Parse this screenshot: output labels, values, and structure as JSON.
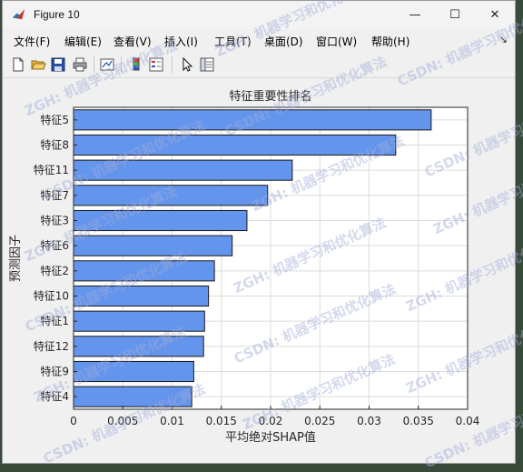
{
  "window": {
    "title": "Figure 10",
    "minimize_glyph": "—",
    "maximize_glyph": "☐",
    "close_glyph": "✕"
  },
  "menu": {
    "items": [
      "文件(F)",
      "编辑(E)",
      "查看(V)",
      "插入(I)",
      "工具(T)",
      "桌面(D)",
      "窗口(W)",
      "帮助(H)"
    ],
    "overflow_glyph": "↘"
  },
  "toolbar": {
    "icons": [
      "new-figure-icon",
      "open-file-icon",
      "save-icon",
      "print-icon",
      "link-plot-icon",
      "colorbar-icon",
      "legend-icon",
      "pointer-icon",
      "property-inspector-icon"
    ]
  },
  "watermarks": [
    "ZGH: 机器学习和优化算法",
    "CSDN: 机器学习和优化算法"
  ],
  "colors": {
    "bar_fill": "#6495ed",
    "bar_edge": "#1a1a1a",
    "axes_bg": "#ffffff",
    "grid": "#dcdcdc"
  },
  "chart_data": {
    "type": "bar",
    "orientation": "horizontal",
    "title": "特征重要性排名",
    "xlabel": "平均绝对SHAP值",
    "ylabel": "预测因子",
    "categories": [
      "特征5",
      "特征8",
      "特征11",
      "特征7",
      "特征3",
      "特征6",
      "特征2",
      "特征10",
      "特征1",
      "特征12",
      "特征9",
      "特征4"
    ],
    "values": [
      0.0363,
      0.0327,
      0.0222,
      0.0197,
      0.0176,
      0.0161,
      0.0143,
      0.0137,
      0.0133,
      0.0132,
      0.0122,
      0.012
    ],
    "xlim": [
      0,
      0.04
    ],
    "xticks": [
      "0",
      "0.005",
      "0.01",
      "0.015",
      "0.02",
      "0.025",
      "0.03",
      "0.035",
      "0.04"
    ],
    "grid": true
  }
}
